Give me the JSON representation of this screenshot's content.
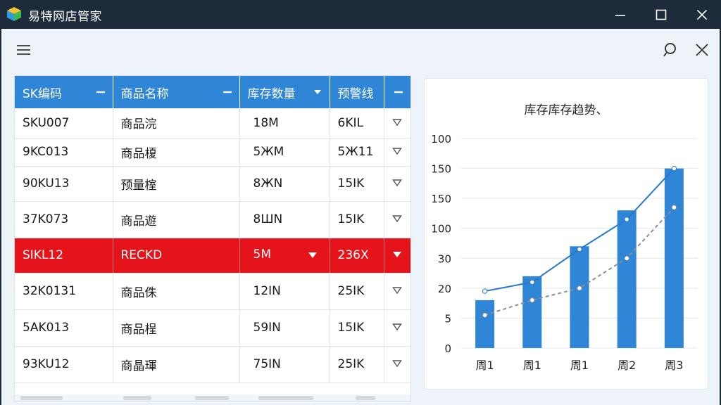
{
  "window": {
    "title": "易特网店管家"
  },
  "table": {
    "headers": [
      "SK编码",
      "商品名称",
      "库存数量",
      "预警线"
    ],
    "rows": [
      {
        "sku": "SKU007",
        "name": "商品浣",
        "qty": "18M",
        "warn": "6KIL",
        "selected": false
      },
      {
        "sku": "9KC013",
        "name": "商品榎",
        "qty": "5ЖM",
        "warn": "5Ж11",
        "selected": false
      },
      {
        "sku": "90KU13",
        "name": "预量榁",
        "qty": "8ЖN",
        "warn": "15IK",
        "selected": false
      },
      {
        "sku": "37K073",
        "name": "商品遊",
        "qty": "8ШN",
        "warn": "15IK",
        "selected": false
      },
      {
        "sku": "SIKL12",
        "name": "RECKD",
        "qty": "5M",
        "warn": "236X",
        "selected": true
      },
      {
        "sku": "32K0131",
        "name": "商品侏",
        "qty": "12ΙN",
        "warn": "25IK",
        "selected": false
      },
      {
        "sku": "5AK013",
        "name": "商品桯",
        "qty": "59IN",
        "warn": "15IK",
        "selected": false
      },
      {
        "sku": "93KU12",
        "name": "商晶琿",
        "qty": "75IN",
        "warn": "25IK",
        "selected": false
      }
    ]
  },
  "chart_data": {
    "type": "bar",
    "title": "库存库存趋势、",
    "categories": [
      "周1",
      "周1",
      "周1",
      "周2",
      "周3"
    ],
    "y_tick_labels": [
      "100",
      "150",
      "150",
      "100",
      "30",
      "20",
      "5",
      "0"
    ],
    "values": [
      1.6,
      2.4,
      3.4,
      4.6,
      6.0
    ],
    "line_series": [
      {
        "values": [
          1.9,
          2.2,
          3.3,
          4.3,
          6.0
        ],
        "style": "solid",
        "color": "#2a78c8"
      },
      {
        "values": [
          1.1,
          1.6,
          2.0,
          3.0,
          4.7
        ],
        "style": "dashed",
        "color": "#8a8f96"
      }
    ],
    "ylim": [
      0,
      7
    ],
    "grid": true,
    "bar_color": "#2f86d6"
  }
}
